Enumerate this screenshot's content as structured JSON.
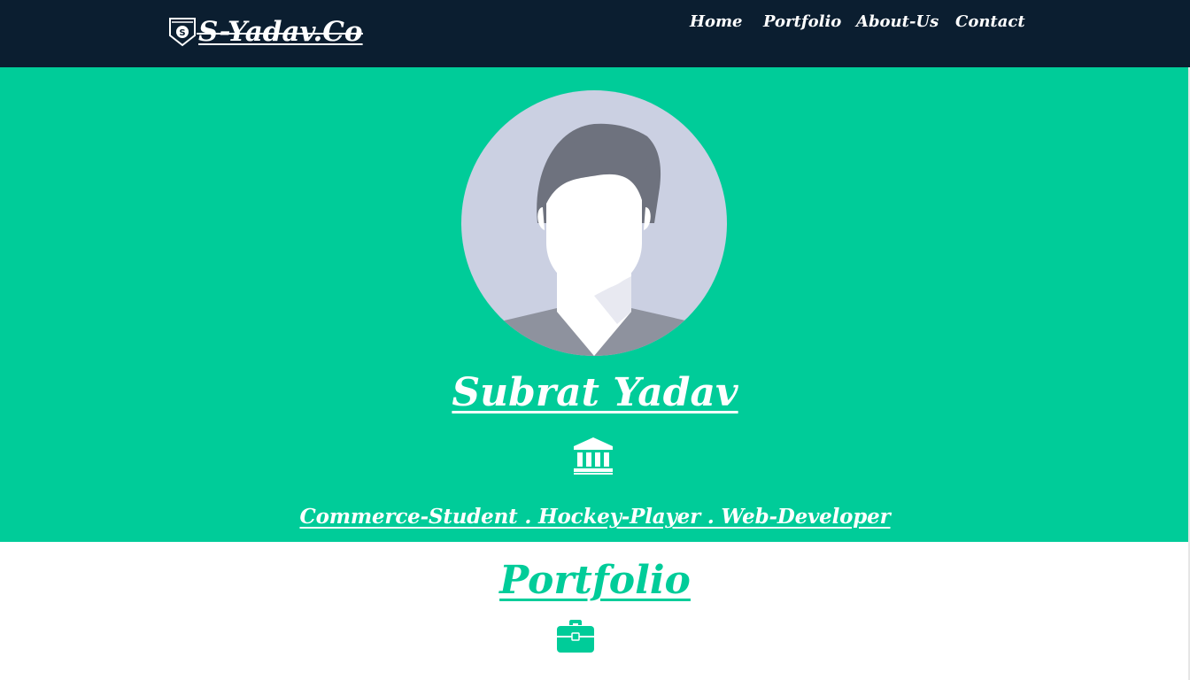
{
  "header": {
    "brand": "S-Yadav.Co",
    "brand_icon": "shield-s-logo-icon",
    "nav": [
      "Home",
      "Portfolio",
      "About-Us",
      "Contact"
    ]
  },
  "hero": {
    "avatar_icon": "user-avatar-placeholder",
    "name": "Subrat Yadav",
    "divider_icon": "bank-icon",
    "tagline": "Commerce-Student . Hockey-Player . Web-Developer"
  },
  "portfolio": {
    "title": "Portfolio",
    "divider_icon": "briefcase-icon"
  },
  "colors": {
    "header_bg": "#0b1e30",
    "accent": "#00cc99",
    "text_light": "#ffffff"
  }
}
